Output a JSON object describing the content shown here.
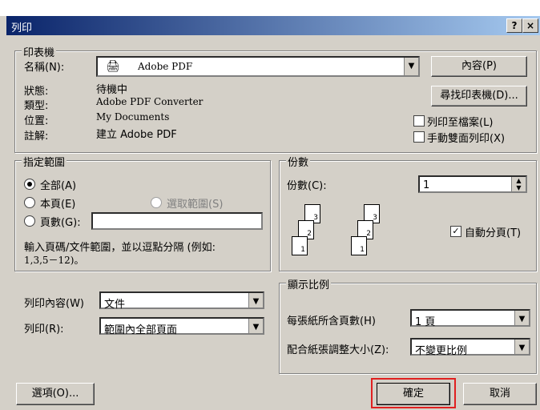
{
  "window": {
    "title": "列印",
    "help_button": "?",
    "close_button": "×"
  },
  "printer": {
    "legend": "印表機",
    "name_label": "名稱(N):",
    "name_value": "Adobe PDF",
    "status_label": "狀態:",
    "status_value": "待機中",
    "type_label": "類型:",
    "type_value": "Adobe PDF Converter",
    "where_label": "位置:",
    "where_value": "My Documents",
    "comment_label": "註解:",
    "comment_value": "建立 Adobe PDF",
    "properties_button": "內容(P)",
    "find_printer_button": "尋找印表機(D)...",
    "print_to_file_label": "列印至檔案(L)",
    "print_to_file_checked": false,
    "manual_duplex_label": "手動雙面列印(X)",
    "manual_duplex_checked": false
  },
  "page_range": {
    "legend": "指定範圍",
    "all_label": "全部(A)",
    "current_label": "本頁(E)",
    "selection_label": "選取範圍(S)",
    "pages_label": "頁數(G):",
    "pages_value": "",
    "hint": "輸入頁碼/文件範圍，並以逗點分隔 (例如:",
    "hint2": "1,3,5－12)。",
    "selected": "all"
  },
  "copies": {
    "legend": "份數",
    "count_label": "份數(C):",
    "count_value": "1",
    "collate_label": "自動分頁(T)",
    "collate_checked": true,
    "page_numbers": [
      "3",
      "2",
      "1",
      "3",
      "2",
      "1"
    ]
  },
  "print_what": {
    "label": "列印內容(W)",
    "value": "文件"
  },
  "print_range": {
    "label": "列印(R):",
    "value": "範圍內全部頁面"
  },
  "zoom": {
    "legend": "顯示比例",
    "pages_per_sheet_label": "每張紙所含頁數(H)",
    "pages_per_sheet_value": "1 頁",
    "scale_label": "配合紙張調整大小(Z):",
    "scale_value": "不變更比例"
  },
  "footer": {
    "options_button": "選項(O)...",
    "ok_button": "確定",
    "cancel_button": "取消"
  },
  "colors": {
    "title_start": "#0a246a",
    "title_end": "#a6caf0",
    "highlight": "#e02020",
    "face": "#d4d0c8"
  }
}
